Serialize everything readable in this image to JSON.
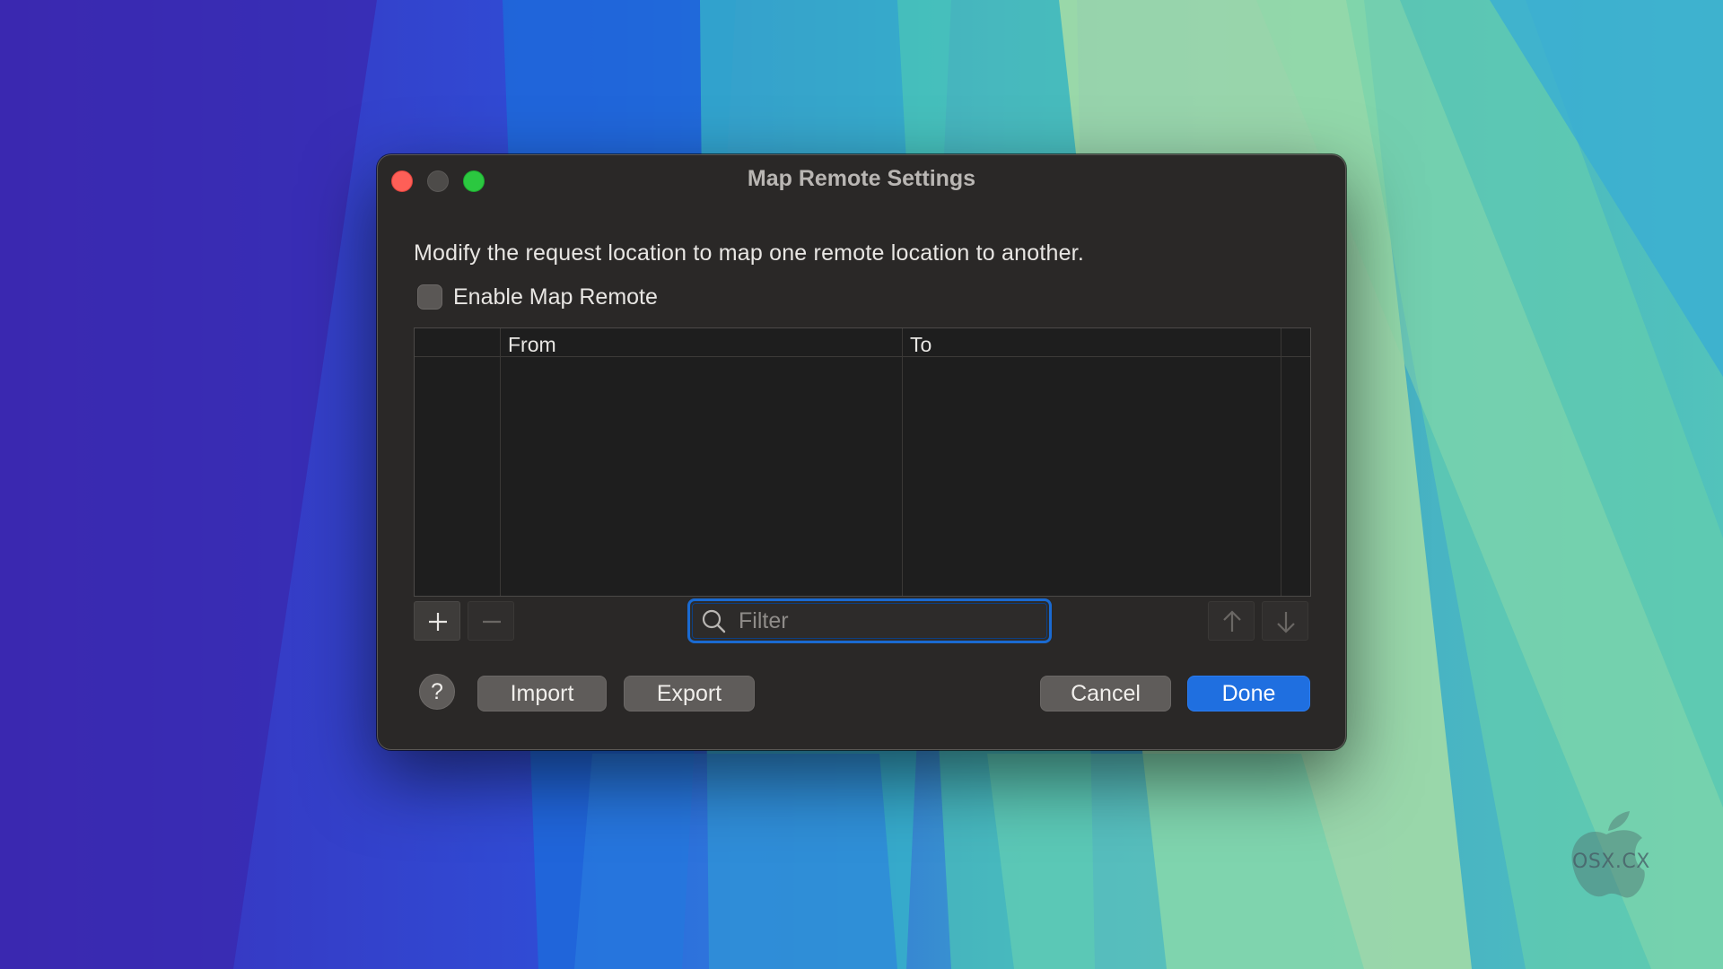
{
  "window": {
    "title": "Map Remote Settings"
  },
  "description": "Modify the request location to map one remote location to another.",
  "enable_checkbox": {
    "label": "Enable Map Remote",
    "checked": false
  },
  "table": {
    "columns": [
      "",
      "From",
      "To",
      ""
    ],
    "rows": []
  },
  "controls": {
    "add_icon": "plus-icon",
    "remove_icon": "minus-icon",
    "move_up_icon": "arrow-up-icon",
    "move_down_icon": "arrow-down-icon"
  },
  "filter": {
    "placeholder": "Filter",
    "value": ""
  },
  "buttons": {
    "help": "?",
    "import": "Import",
    "export": "Export",
    "cancel": "Cancel",
    "done": "Done"
  },
  "watermark": {
    "text": "OSX.CX"
  },
  "colors": {
    "accent": "#1f6fe0",
    "close": "#fe5f57",
    "zoom": "#2bc840"
  }
}
